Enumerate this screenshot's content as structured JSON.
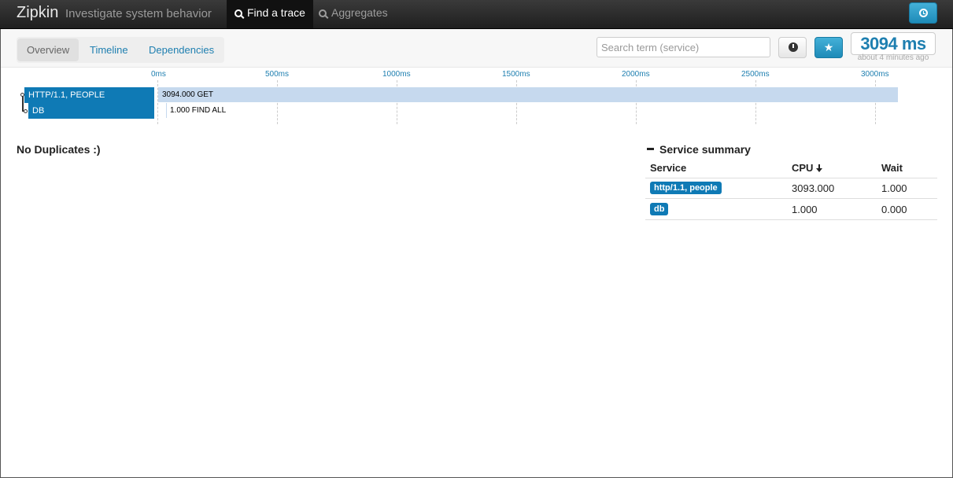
{
  "navbar": {
    "brand": "Zipkin",
    "tagline": "Investigate system behavior",
    "tabs": [
      {
        "label": "Find a trace",
        "icon": "search-icon"
      },
      {
        "label": "Aggregates",
        "icon": "search-icon"
      }
    ],
    "clock_icon": "clock-icon"
  },
  "toolbar": {
    "tabs": [
      "Overview",
      "Timeline",
      "Dependencies"
    ],
    "active_tab": "Overview",
    "search_placeholder": "Search term (service)",
    "duration": "3094 ms",
    "relative_time": "about 4 minutes ago"
  },
  "timeline": {
    "ticks": [
      "0ms",
      "500ms",
      "1000ms",
      "1500ms",
      "2000ms",
      "2500ms",
      "3000ms"
    ],
    "spans": [
      {
        "service": "HTTP/1.1, PEOPLE",
        "label": "3094.000 GET"
      },
      {
        "service": "DB",
        "label": "1.000 FIND ALL"
      }
    ]
  },
  "duplicates_message": "No Duplicates :)",
  "service_summary": {
    "title": "Service summary",
    "headers": [
      "Service",
      "CPU",
      "Wait"
    ],
    "rows": [
      {
        "service": "http/1.1, people",
        "cpu": "3093.000",
        "wait": "1.000"
      },
      {
        "service": "db",
        "cpu": "1.000",
        "wait": "0.000"
      }
    ]
  },
  "colors": {
    "accent": "#0f7ab5",
    "span_bar": "#c6d9ee",
    "link": "#1e7fb0"
  }
}
